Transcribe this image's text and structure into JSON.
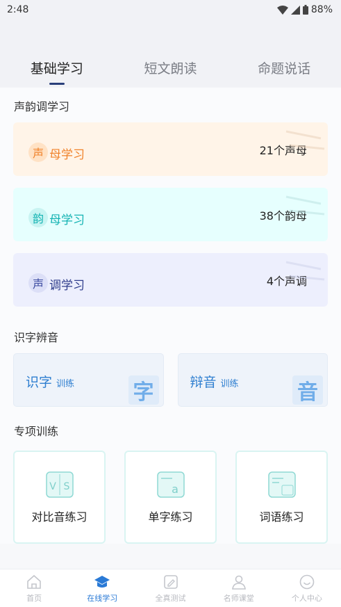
{
  "status_bar": {
    "time": "2:48",
    "battery": "88%"
  },
  "tabs": [
    {
      "label": "基础学习",
      "active": true
    },
    {
      "label": "短文朗读",
      "active": false
    },
    {
      "label": "命题说话",
      "active": false
    }
  ],
  "sections": {
    "shengyun": {
      "title": "声韵调学习",
      "cards": [
        {
          "badge": "声",
          "label": "母学习",
          "count": "21个声母",
          "color": "#f0822a"
        },
        {
          "badge": "韵",
          "label": "母学习",
          "count": "38个韵母",
          "color": "#14b3b3"
        },
        {
          "badge": "声",
          "label": "调学习",
          "count": "4个声调",
          "color": "#2f3d8c"
        }
      ]
    },
    "shizi": {
      "title": "识字辨音",
      "cards": [
        {
          "main": "识字",
          "sub": "训练",
          "bg_char": "字"
        },
        {
          "main": "辩音",
          "sub": "训练",
          "bg_char": "音"
        }
      ]
    },
    "zhuanxiang": {
      "title": "专项训练",
      "cards": [
        {
          "label": "对比音练习",
          "icon": "vs-icon"
        },
        {
          "label": "单字练习",
          "icon": "letter-a-icon"
        },
        {
          "label": "词语练习",
          "icon": "word-card-icon"
        }
      ]
    }
  },
  "bottom_nav": [
    {
      "label": "首页",
      "icon": "home-icon",
      "active": false
    },
    {
      "label": "在线学习",
      "icon": "graduation-cap-icon",
      "active": true
    },
    {
      "label": "全真测试",
      "icon": "edit-icon",
      "active": false
    },
    {
      "label": "名师课堂",
      "icon": "teacher-icon",
      "active": false
    },
    {
      "label": "个人中心",
      "icon": "smile-icon",
      "active": false
    }
  ],
  "colors": {
    "accent": "#2a7ad6",
    "tab_indicator": "#2a3f7a"
  }
}
